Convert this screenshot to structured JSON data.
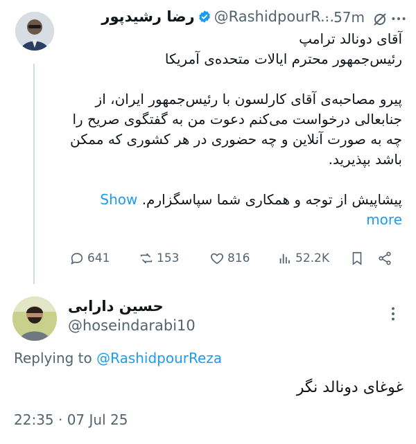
{
  "tweet": {
    "display_name": "رضا رشیدپور",
    "handle": "@RashidpourR...",
    "separator": "·",
    "time": "57m",
    "lines": [
      "آقای دونالد ترامپ",
      "رئیس‌جمهور محترم ایالات متحده‌ی آمریکا",
      "",
      "پیرو مصاحبه‌ی آقای کارلسون با رئیس‌جمهور ایران، از",
      "جنابعالی درخواست می‌کنم دعوت من به گفتگوی صریح را",
      "چه به صورت آنلاین و چه حضوری در هر کشوری که ممکن",
      "باشد بپذیرید.",
      "",
      "پیشاپیش از توجه و همکاری شما سپاسگزارم."
    ],
    "show_more": "Show more",
    "actions": {
      "replies": "641",
      "reposts": "153",
      "likes": "816",
      "views": "52.2K"
    }
  },
  "reply": {
    "display_name": "حسین دارابی",
    "handle": "@hoseindarabi10",
    "replying_prefix": "Replying to ",
    "replying_to": "@RashidpourReza",
    "text": "غوغای دونالد نگر",
    "timestamp": "22:35 · 07 Jul 25"
  },
  "colors": {
    "accent": "#1d9bf0",
    "muted": "#536471",
    "text": "#0f1419",
    "verified": "#1d9bf0"
  }
}
